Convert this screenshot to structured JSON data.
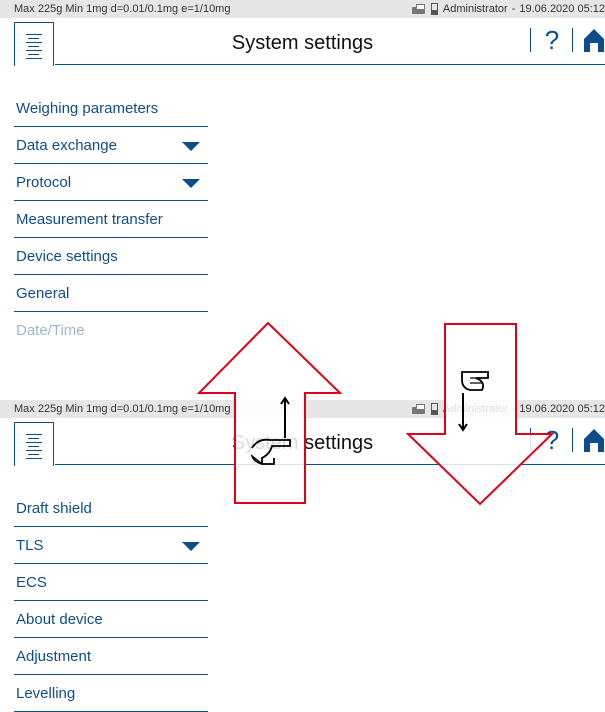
{
  "status_bar": {
    "spec": "Max 225g  Min 1mg  d=0.01/0.1mg  e=1/10mg",
    "user": "Administrator",
    "datetime": "19.06.2020 05:12"
  },
  "header": {
    "title": "System settings",
    "help_label": "?"
  },
  "top_menu": {
    "items": [
      {
        "label": "Weighing parameters",
        "has_dropdown": false
      },
      {
        "label": "Data exchange",
        "has_dropdown": true
      },
      {
        "label": "Protocol",
        "has_dropdown": true
      },
      {
        "label": "Measurement transfer",
        "has_dropdown": false
      },
      {
        "label": "Device settings",
        "has_dropdown": false
      },
      {
        "label": "General",
        "has_dropdown": false
      },
      {
        "label": "Date/Time",
        "has_dropdown": false
      }
    ]
  },
  "bottom_menu": {
    "items": [
      {
        "label": "Draft shield",
        "has_dropdown": false
      },
      {
        "label": "TLS",
        "has_dropdown": true
      },
      {
        "label": "ECS",
        "has_dropdown": false
      },
      {
        "label": "About device",
        "has_dropdown": false
      },
      {
        "label": "Adjustment",
        "has_dropdown": false
      },
      {
        "label": "Levelling",
        "has_dropdown": false
      }
    ]
  },
  "overlay": {
    "up_arrow_color": "#e0001a",
    "down_arrow_color": "#e0001a",
    "up_gesture": "swipe-up",
    "down_gesture": "swipe-down"
  },
  "colors": {
    "accent": "#0e4d8c",
    "status_bg": "#e6e6e6",
    "arrow": "#e0001a"
  }
}
